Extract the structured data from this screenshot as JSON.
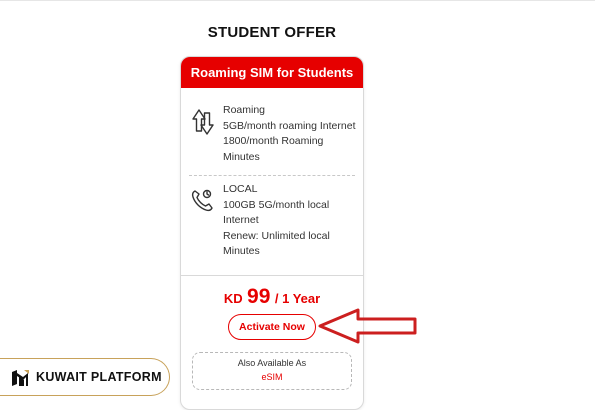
{
  "page": {
    "title": "STUDENT OFFER"
  },
  "card": {
    "header": "Roaming SIM for Students",
    "features": [
      {
        "icon": "roaming-arrows-icon",
        "lines": [
          "Roaming",
          "5GB/month roaming Internet",
          "1800/month Roaming",
          "Minutes"
        ]
      },
      {
        "icon": "phone-icon",
        "lines": [
          "LOCAL",
          "100GB 5G/month local",
          "Internet",
          "Renew: Unlimited local",
          "Minutes"
        ]
      }
    ],
    "price": {
      "currency": "KD",
      "amount": "99",
      "period": "/ 1 Year"
    },
    "activate_label": "Activate Now",
    "also_available": {
      "label": "Also Available As",
      "link": "eSIM"
    }
  },
  "annotation": {
    "icon": "red-arrow-icon",
    "color": "#cc1f1f"
  },
  "colors": {
    "accent": "#e60000",
    "badge_border": "#c8a25a"
  },
  "badge": {
    "logo": "kuwait-platform-logo",
    "name": "KUWAIT PLATFORM"
  }
}
